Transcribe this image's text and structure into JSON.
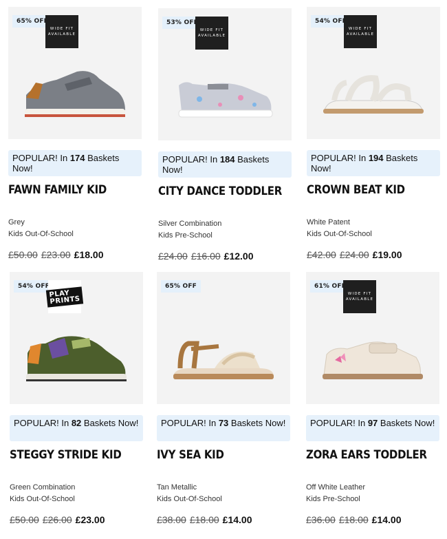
{
  "products": [
    {
      "discount": "65% OFF",
      "badge_text": "WIDE FIT AVAILABLE",
      "popular_prefix": "POPULAR! In ",
      "popular_count": "174",
      "popular_suffix": " Baskets Now!",
      "name": "FAWN FAMILY KID",
      "colour": "Grey",
      "segment": "Kids Out-Of-School",
      "price_rrp": "£50.00",
      "price_was": "£23.00",
      "price_now": "£18.00",
      "shoe_color": "#7b7f86"
    },
    {
      "discount": "53% OFF",
      "badge_text": "WIDE FIT AVAILABLE",
      "popular_prefix": "POPULAR! In ",
      "popular_count": "184",
      "popular_suffix": " Baskets Now!",
      "name": "CITY DANCE TODDLER",
      "colour": "Silver Combination",
      "segment": "Kids Pre-School",
      "price_rrp": "£24.00",
      "price_was": "£16.00",
      "price_now": "£12.00",
      "shoe_color": "#c9ccd6"
    },
    {
      "discount": "54% OFF",
      "badge_text": "WIDE FIT AVAILABLE",
      "popular_prefix": "POPULAR! In ",
      "popular_count": "194",
      "popular_suffix": " Baskets Now!",
      "name": "CROWN BEAT KID",
      "colour": "White Patent",
      "segment": "Kids Out-Of-School",
      "price_rrp": "£42.00",
      "price_was": "£24.00",
      "price_now": "£19.00",
      "shoe_color": "#f4f2ee"
    },
    {
      "discount": "54% OFF",
      "badge_text": "PLAY PRINTS",
      "popular_prefix": "POPULAR! In ",
      "popular_count": "82",
      "popular_suffix": " Baskets Now!",
      "name": "STEGGY STRIDE KID",
      "colour": "Green Combination",
      "segment": "Kids Out-Of-School",
      "price_rrp": "£50.00",
      "price_was": "£26.00",
      "price_now": "£23.00",
      "shoe_color": "#4c5e2c"
    },
    {
      "discount": "65% OFF",
      "badge_text": "",
      "popular_prefix": "POPULAR! In ",
      "popular_count": "73",
      "popular_suffix": " Baskets Now!",
      "name": "IVY SEA KID",
      "colour": "Tan Metallic",
      "segment": "Kids Out-Of-School",
      "price_rrp": "£38.00",
      "price_was": "£18.00",
      "price_now": "£14.00",
      "shoe_color": "#a8763f"
    },
    {
      "discount": "61% OFF",
      "badge_text": "WIDE FIT AVAILABLE",
      "popular_prefix": "POPULAR! In ",
      "popular_count": "97",
      "popular_suffix": " Baskets Now!",
      "name": "ZORA EARS TODDLER",
      "colour": "Off White Leather",
      "segment": "Kids Pre-School",
      "price_rrp": "£36.00",
      "price_was": "£18.00",
      "price_now": "£14.00",
      "shoe_color": "#efe6da"
    }
  ]
}
